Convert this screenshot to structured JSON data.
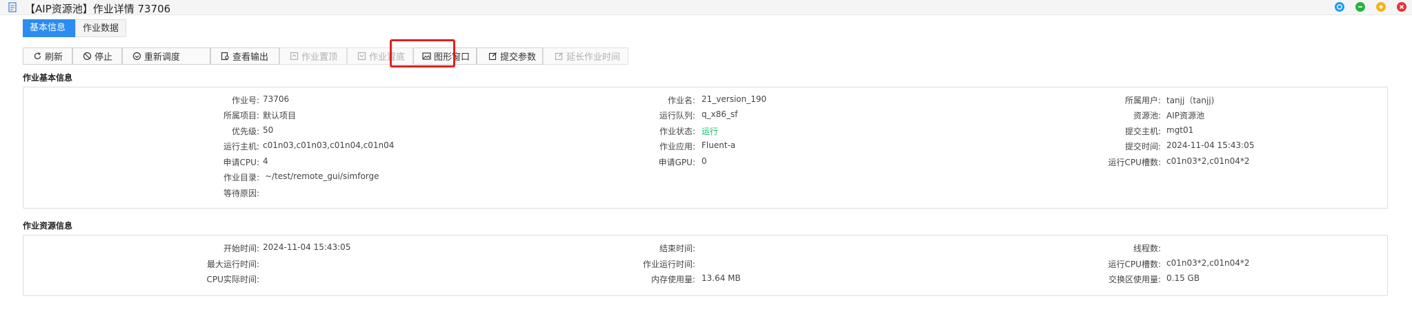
{
  "window": {
    "title": "【AIP资源池】作业详情 73706"
  },
  "tabs": [
    "基本信息",
    "作业数据"
  ],
  "toolbar": {
    "refresh": "刷新",
    "stop": "停止",
    "reschedule": "重新调度",
    "view_output": "查看输出",
    "pin_top": "作业置顶",
    "pin_bottom": "作业置底",
    "graphic_window": "图形窗口",
    "submit_params": "提交参数",
    "extend_time": "延长作业时间"
  },
  "basic_info": {
    "title": "作业基本信息",
    "job_id_label": "作业号:",
    "job_id": "73706",
    "job_name_label": "作业名:",
    "job_name": "21_version_190",
    "user_label": "所属用户:",
    "user": "tanjj（tanjj)",
    "project_label": "所属项目:",
    "project": "默认项目",
    "queue_label": "运行队列:",
    "queue": "q_x86_sf",
    "pool_label": "资源池:",
    "pool": "AIP资源池",
    "priority_label": "优先级:",
    "priority": "50",
    "status_label": "作业状态:",
    "status": "运行",
    "submit_host_label": "提交主机:",
    "submit_host": "mgt01",
    "run_hosts_label": "运行主机:",
    "run_hosts": "c01n03,c01n03,c01n04,c01n04",
    "app_label": "作业应用:",
    "app": "Fluent-a",
    "submit_time_label": "提交时间:",
    "submit_time": "2024-11-04 15:43:05",
    "req_cpu_label": "申请CPU:",
    "req_cpu": "4",
    "req_gpu_label": "申请GPU:",
    "req_gpu": "0",
    "cpu_slots_label": "运行CPU槽数:",
    "cpu_slots": "c01n03*2,c01n04*2",
    "workdir_label": "作业目录:",
    "workdir": "~/test/remote_gui/simforge",
    "wait_reason_label": "等待原因:",
    "wait_reason": ""
  },
  "resource_info": {
    "title": "作业资源信息",
    "start_time_label": "开始时间:",
    "start_time": "2024-11-04 15:43:05",
    "end_time_label": "结束时间:",
    "end_time": "",
    "threads_label": "线程数:",
    "threads": "",
    "max_runtime_label": "最大运行时间:",
    "max_runtime": "",
    "runtime_label": "作业运行时间:",
    "runtime": "",
    "cpu_slots_label": "运行CPU槽数:",
    "cpu_slots": "c01n03*2,c01n04*2",
    "cpu_time_label": "CPU实际时间:",
    "cpu_time": "",
    "memory_label": "内存使用量:",
    "memory": "13.64 MB",
    "swap_label": "交换区使用量:",
    "swap": "0.15 GB"
  },
  "colors": {
    "accent": "#2d8cf0",
    "status_running": "#19be6b",
    "highlight": "#e0201c"
  }
}
